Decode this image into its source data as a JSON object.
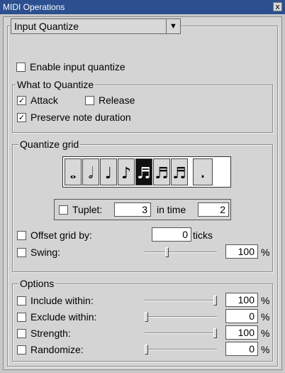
{
  "window": {
    "title": "MIDI Operations",
    "close_glyph": "x"
  },
  "dropdown": {
    "label": "Input Quantize",
    "arrow": "▼"
  },
  "enable": {
    "label": "Enable input quantize",
    "checked": false
  },
  "what": {
    "legend": "What to Quantize",
    "attack": {
      "label": "Attack",
      "checked": true
    },
    "release": {
      "label": "Release",
      "checked": false
    },
    "preserve": {
      "label": "Preserve note duration",
      "checked": true
    }
  },
  "grid": {
    "legend": "Quantize grid",
    "notes": [
      "𝅝",
      "𝅗𝅥",
      "♩",
      "♪",
      "♬",
      "♬",
      "♬",
      "."
    ],
    "selected_index": 4,
    "tuplet": {
      "label": "Tuplet:",
      "value": "3",
      "in_time_label": "in time",
      "in_time_value": "2",
      "checked": false
    },
    "offset": {
      "label": "Offset grid by:",
      "value": "0",
      "unit": "ticks",
      "checked": false
    },
    "swing": {
      "label": "Swing:",
      "value": "100",
      "unit": "%",
      "checked": false,
      "level": 0.3
    }
  },
  "options": {
    "legend": "Options",
    "rows": [
      {
        "label": "Include within:",
        "value": "100",
        "unit": "%",
        "checked": false,
        "level": 1.0
      },
      {
        "label": "Exclude within:",
        "value": "0",
        "unit": "%",
        "checked": false,
        "level": 0.0
      },
      {
        "label": "Strength:",
        "value": "100",
        "unit": "%",
        "checked": false,
        "level": 1.0
      },
      {
        "label": "Randomize:",
        "value": "0",
        "unit": "%",
        "checked": false,
        "level": 0.0
      }
    ]
  },
  "check_glyph": "✓"
}
